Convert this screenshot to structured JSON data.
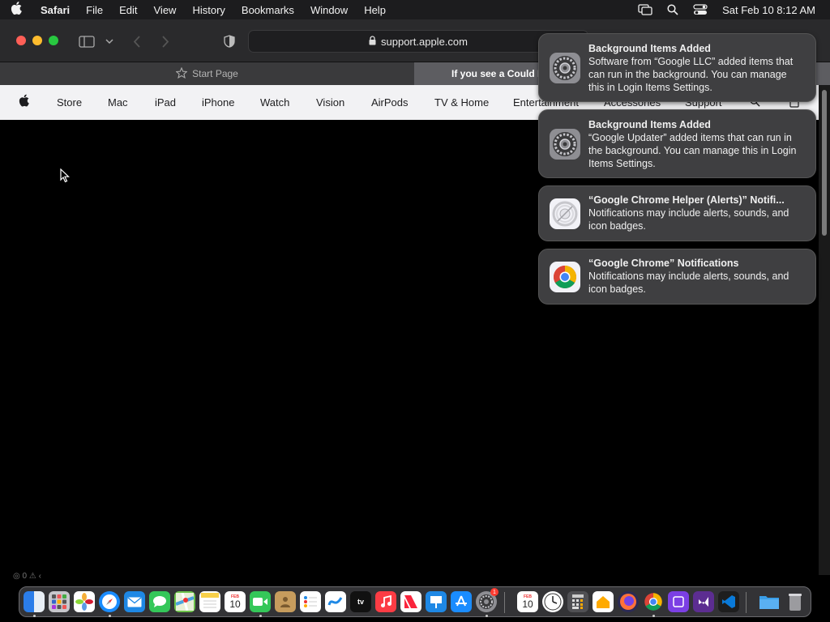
{
  "menubar": {
    "app_name": "Safari",
    "menus": [
      "File",
      "Edit",
      "View",
      "History",
      "Bookmarks",
      "Window",
      "Help"
    ],
    "clock": "Sat Feb 10  8:12 AM"
  },
  "toolbar": {
    "url": "support.apple.com"
  },
  "tabs": [
    {
      "label": "Start Page"
    },
    {
      "label": "If you see a Could No"
    }
  ],
  "apple_nav": {
    "items": [
      "Store",
      "Mac",
      "iPad",
      "iPhone",
      "Watch",
      "Vision",
      "AirPods",
      "TV & Home",
      "Entertainment",
      "Accessories",
      "Support"
    ]
  },
  "statusbar": {
    "text": "◎ 0 ⚠ ‹"
  },
  "notifications": [
    {
      "title": "Background Items Added",
      "body": "Software from “Google LLC” added items that can run in the background. You can manage this in Login Items Settings.",
      "icon": "system-settings-icon"
    },
    {
      "title": "Background Items Added",
      "body": "“Google Updater” added items that can run in the background. You can manage this in Login Items Settings.",
      "icon": "system-settings-icon"
    },
    {
      "title": "“Google Chrome Helper (Alerts)” Notifi...",
      "body": "Notifications may include alerts, sounds, and icon badges.",
      "icon": "chrome-helper-icon"
    },
    {
      "title": "“Google Chrome” Notifications",
      "body": "Notifications may include alerts, sounds, and icon badges.",
      "icon": "chrome-icon"
    }
  ],
  "dock": {
    "calendar_day": "10",
    "calendar_month": "FEB",
    "settings_badge": "1",
    "apps": [
      "finder",
      "launchpad",
      "photos",
      "safari",
      "mail",
      "messages",
      "maps",
      "notes",
      "calendar",
      "facetime",
      "contacts",
      "reminders",
      "freeform",
      "apple-tv",
      "music",
      "news",
      "keynote",
      "app-store",
      "system-settings",
      "calendar",
      "clock",
      "calculator",
      "home",
      "firefox",
      "chrome",
      "visual-studio",
      "vs-code",
      "downloads-folder",
      "trash"
    ],
    "tv_label": "tv"
  },
  "colors": {
    "menubar_bg": "#1c1c1e",
    "notification_bg": "#3f3f41",
    "nav_bg": "#f2f2f4",
    "active_tab": "#5d5d61"
  }
}
